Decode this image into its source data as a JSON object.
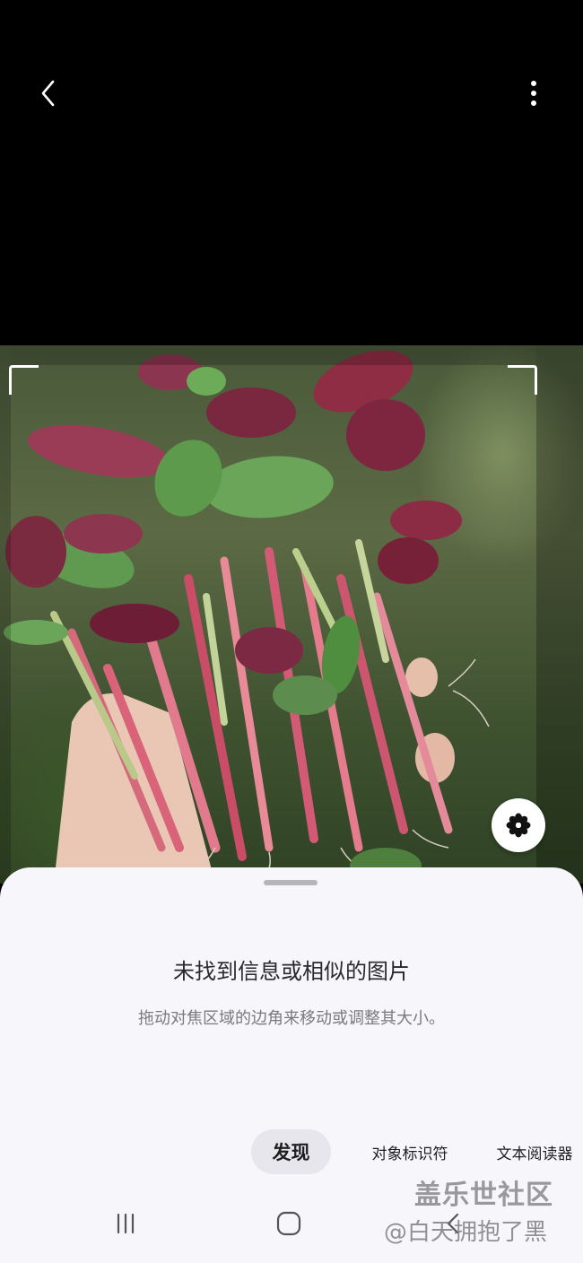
{
  "icons": {
    "back": "chevron-left-icon",
    "more": "more-vertical-icon",
    "bixby": "bixby-flower-icon",
    "nav_recent": "recent-apps-icon",
    "nav_home": "home-icon",
    "nav_back": "back-nav-icon"
  },
  "colors": {
    "sheet_bg": "#f7f6fb",
    "active_tab_bg": "#e7e6ec",
    "text_primary": "#2a2a2c",
    "text_secondary": "#7a7a7e"
  },
  "result": {
    "title": "未找到信息或相似的图片",
    "subtitle": "拖动对焦区域的边角来移动或调整其大小。"
  },
  "tabs": [
    {
      "label": "发现",
      "selected": true
    },
    {
      "label": "对象标识符",
      "selected": false
    },
    {
      "label": "文本阅读器",
      "selected": false
    }
  ],
  "watermark": {
    "line1": "盖乐世社区",
    "line2": "@白天拥抱了黑"
  }
}
